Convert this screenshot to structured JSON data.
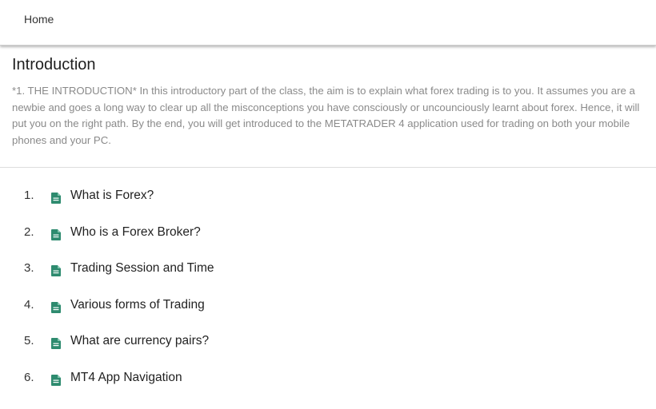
{
  "nav": {
    "home_label": "Home"
  },
  "section": {
    "title": "Introduction",
    "description": "*1. THE INTRODUCTION* In this introductory part of the class, the aim is to explain what forex trading is to you. It assumes you are a newbie and goes a long way to clear up all the misconceptions you have consciously or uncounciously learnt about forex. Hence, it will put you on the right path. By the end, you will get introduced to the METATRADER 4 application used for trading on both your mobile phones and your PC."
  },
  "lessons": [
    {
      "number": "1.",
      "title": "What is Forex?",
      "icon": "document-icon"
    },
    {
      "number": "2.",
      "title": "Who is a Forex Broker?",
      "icon": "document-icon"
    },
    {
      "number": "3.",
      "title": "Trading Session and Time",
      "icon": "document-icon"
    },
    {
      "number": "4.",
      "title": "Various forms of Trading",
      "icon": "document-icon"
    },
    {
      "number": "5.",
      "title": "What are currency pairs?",
      "icon": "document-icon"
    },
    {
      "number": "6.",
      "title": "MT4 App Navigation",
      "icon": "document-icon"
    }
  ],
  "colors": {
    "icon_accent": "#2e8b6f",
    "description_text": "#8a8a8a"
  }
}
